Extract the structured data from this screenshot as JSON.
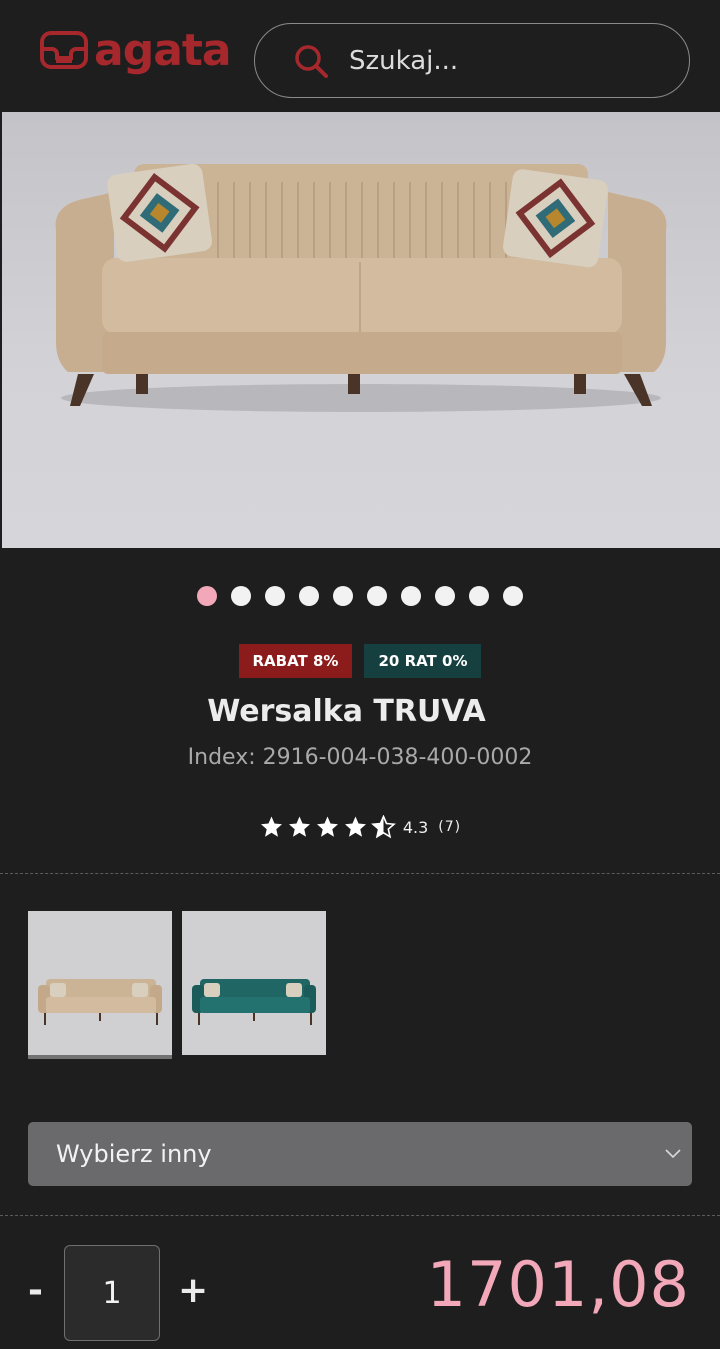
{
  "header": {
    "logo_text": "agata",
    "search_placeholder": "Szukaj..."
  },
  "gallery": {
    "slide_count": 10,
    "active_slide": 1
  },
  "badges": {
    "discount": "RABAT 8%",
    "installments": "20 RAT 0%"
  },
  "product": {
    "title": "Wersalka TRUVA",
    "index": "Index: 2916-004-038-400-0002",
    "rating_value": "4.3",
    "rating_count": "(7)",
    "rating_stars": 4.3
  },
  "variants": [
    {
      "name": "beige",
      "selected": true
    },
    {
      "name": "teal",
      "selected": false
    }
  ],
  "select": {
    "label": "Wybierz inny"
  },
  "purchase": {
    "minus": "-",
    "quantity": "1",
    "plus": "+",
    "price": "1701,08"
  },
  "colors": {
    "brand": "#a7282c",
    "price": "#f2a8b8",
    "discount_badge": "#8c1c1c",
    "installments_badge": "#163f40",
    "background": "#1e1e1f"
  }
}
